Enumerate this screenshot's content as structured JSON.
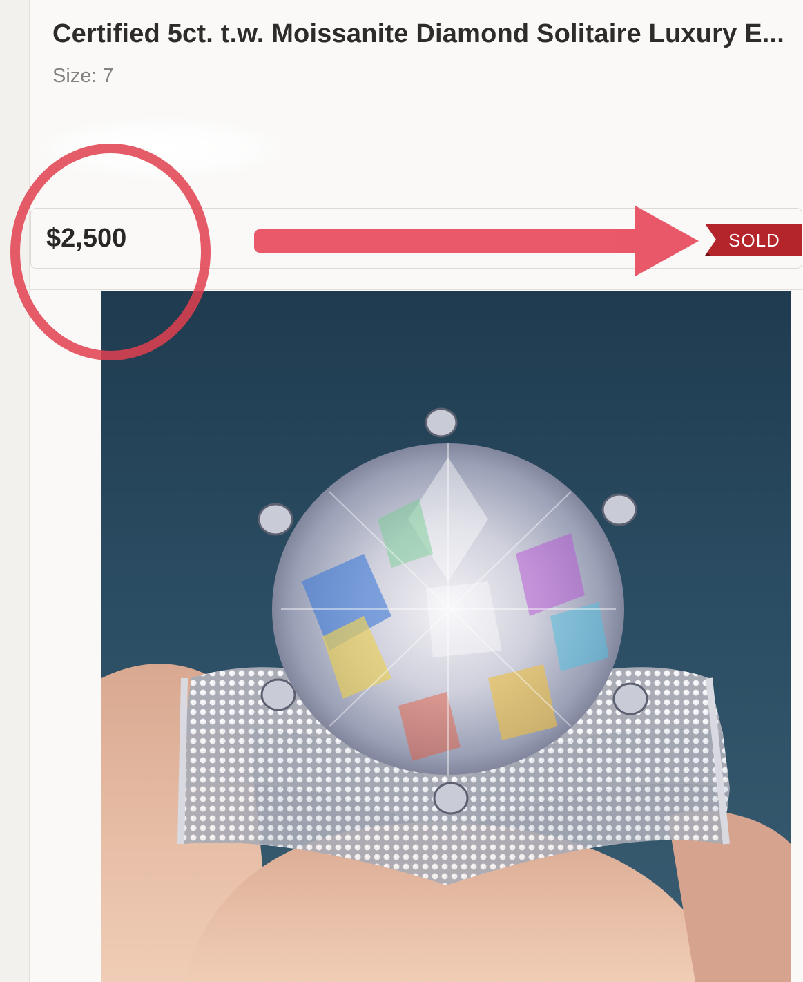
{
  "listing": {
    "title": "Certified 5ct. t.w. Moissanite Diamond Solitaire Luxury E...",
    "size_label": "Size:",
    "size_value": "7",
    "price": "$2,500",
    "status_badge": "SOLD"
  },
  "photo": {
    "subject": "moissanite-solitaire-ring-in-fingers"
  },
  "annotations": {
    "circle_color": "#e0404f",
    "arrow_color": "#e8475a"
  },
  "colors": {
    "badge": "#b3252b",
    "title": "#2e2b2b",
    "muted": "#858282",
    "photo_background": "#2b4d63"
  }
}
